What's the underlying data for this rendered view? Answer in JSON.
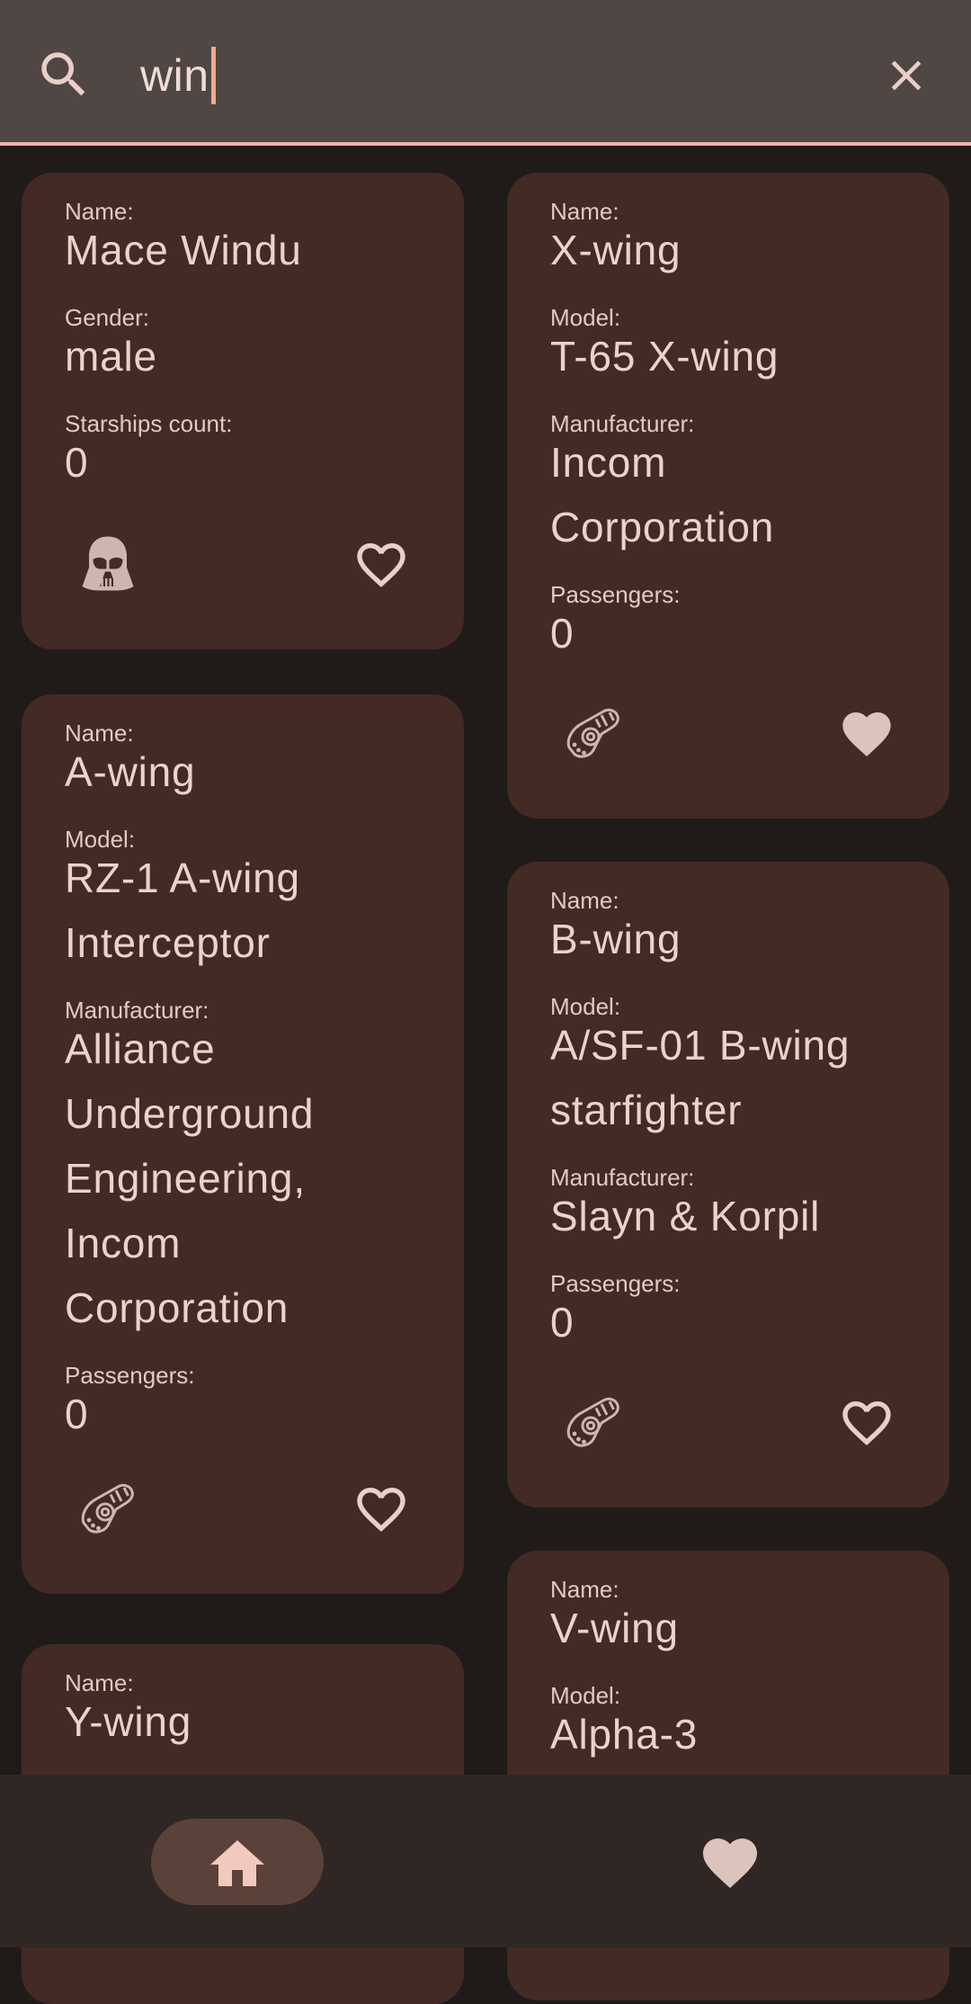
{
  "search": {
    "value": "win"
  },
  "labels": {
    "name": "Name:",
    "gender": "Gender:",
    "starships_count": "Starships count:",
    "model": "Model:",
    "manufacturer": "Manufacturer:",
    "passengers": "Passengers:"
  },
  "cards": {
    "mace": {
      "name": "Mace Windu",
      "gender": "male",
      "starships_count": "0",
      "type_icon": "darth-vader-helmet-icon",
      "favorite": false
    },
    "xwing": {
      "name": "X-wing",
      "model": "T-65 X-wing",
      "manufacturer_lines": [
        "Incom",
        "Corporation"
      ],
      "passengers": "0",
      "type_icon": "starship-icon",
      "favorite": true
    },
    "awing": {
      "name": "A-wing",
      "model_lines": [
        "RZ-1 A-wing",
        "Interceptor"
      ],
      "manufacturer_lines": [
        "Alliance",
        "Underground",
        "Engineering,",
        "Incom",
        "Corporation"
      ],
      "passengers": "0",
      "type_icon": "starship-icon",
      "favorite": false
    },
    "bwing": {
      "name": "B-wing",
      "model_lines": [
        "A/SF-01 B-wing",
        "starfighter"
      ],
      "manufacturer": "Slayn & Korpil",
      "passengers": "0",
      "type_icon": "starship-icon",
      "favorite": false
    },
    "ywing": {
      "name": "Y-wing"
    },
    "vwing": {
      "name": "V-wing",
      "model": "Alpha-3"
    }
  },
  "nav": {
    "items": [
      "home",
      "favorites"
    ],
    "selected": "home"
  },
  "colors": {
    "background": "#201b19",
    "card": "#432a24",
    "search_bar": "#504644",
    "accent": "#f2b6a6",
    "text": "#ecd2ca",
    "bottom_nav": "#302624",
    "nav_active": "#5a4239"
  }
}
